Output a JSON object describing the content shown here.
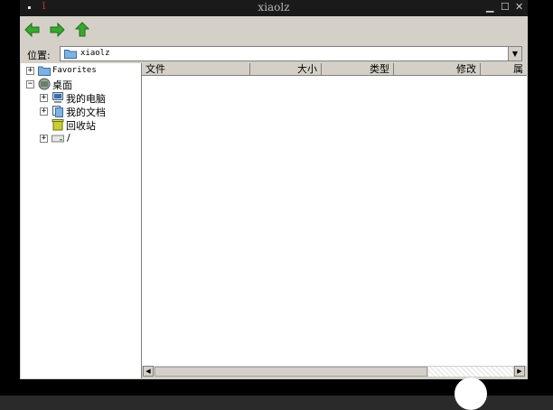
{
  "window": {
    "title": "xiaolz"
  },
  "location": {
    "label": "位置:",
    "value": "xiaolz"
  },
  "tree": {
    "items": [
      {
        "label": "Favorites",
        "expander": "+"
      },
      {
        "label": "桌面",
        "expander": "−"
      },
      {
        "label": "我的电脑",
        "expander": "+"
      },
      {
        "label": "我的文档",
        "expander": "+"
      },
      {
        "label": "回收站",
        "expander": ""
      },
      {
        "label": "/",
        "expander": "+"
      }
    ]
  },
  "list": {
    "columns": [
      "文件",
      "大小",
      "类型",
      "修改",
      "属"
    ]
  },
  "colors": {
    "nav_green": "#3aa830",
    "face": "#d4d0c8"
  }
}
